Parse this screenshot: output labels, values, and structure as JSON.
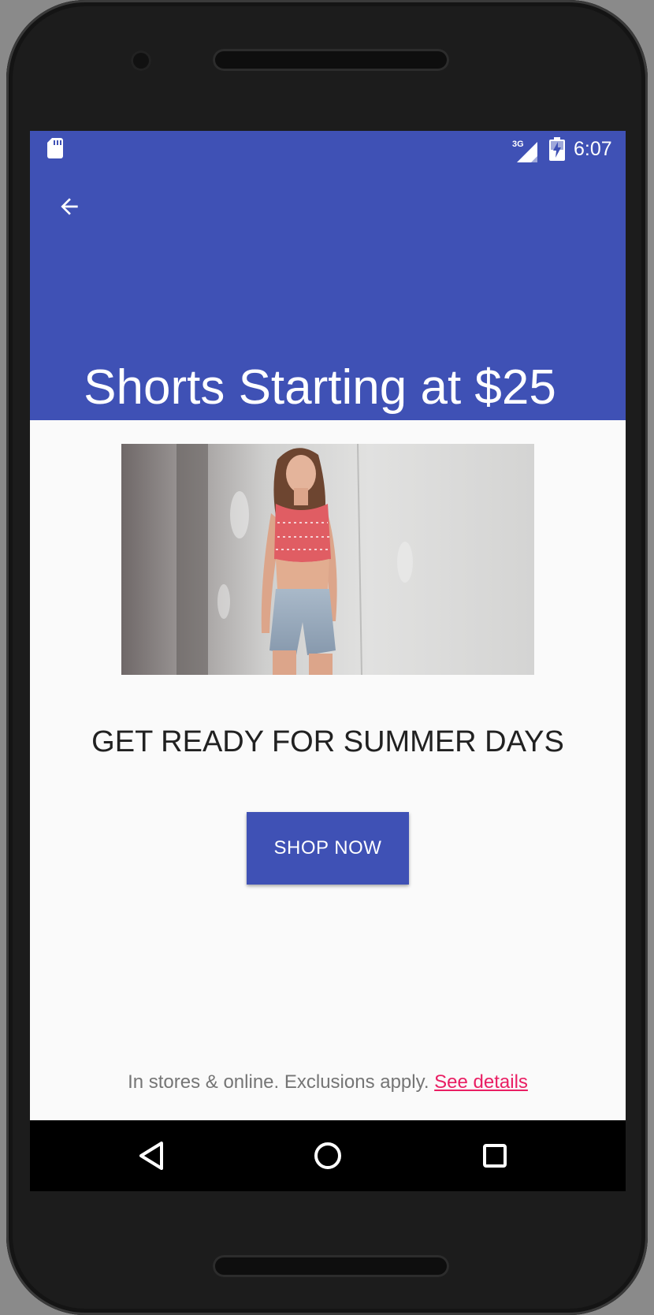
{
  "status_bar": {
    "time": "6:07",
    "network": "3G",
    "icons": [
      "sd-card-icon",
      "cellular-signal-icon",
      "battery-charging-icon"
    ]
  },
  "app_bar": {
    "back_icon": "arrow-back-icon",
    "title": "Shorts Starting at $25"
  },
  "content": {
    "hero_image": "woman-in-red-crop-top-and-denim-shorts",
    "headline": "GET READY FOR SUMMER DAYS",
    "cta_label": "SHOP NOW",
    "footer_text": "In stores & online. Exclusions apply. ",
    "footer_link": "See details"
  },
  "nav_bar": {
    "icons": [
      "back-triangle-icon",
      "home-circle-icon",
      "recents-square-icon"
    ]
  },
  "colors": {
    "primary": "#3f51b5",
    "accent": "#e91e63",
    "background": "#fafafa",
    "headline_text": "#212121",
    "secondary_text": "#757575"
  }
}
